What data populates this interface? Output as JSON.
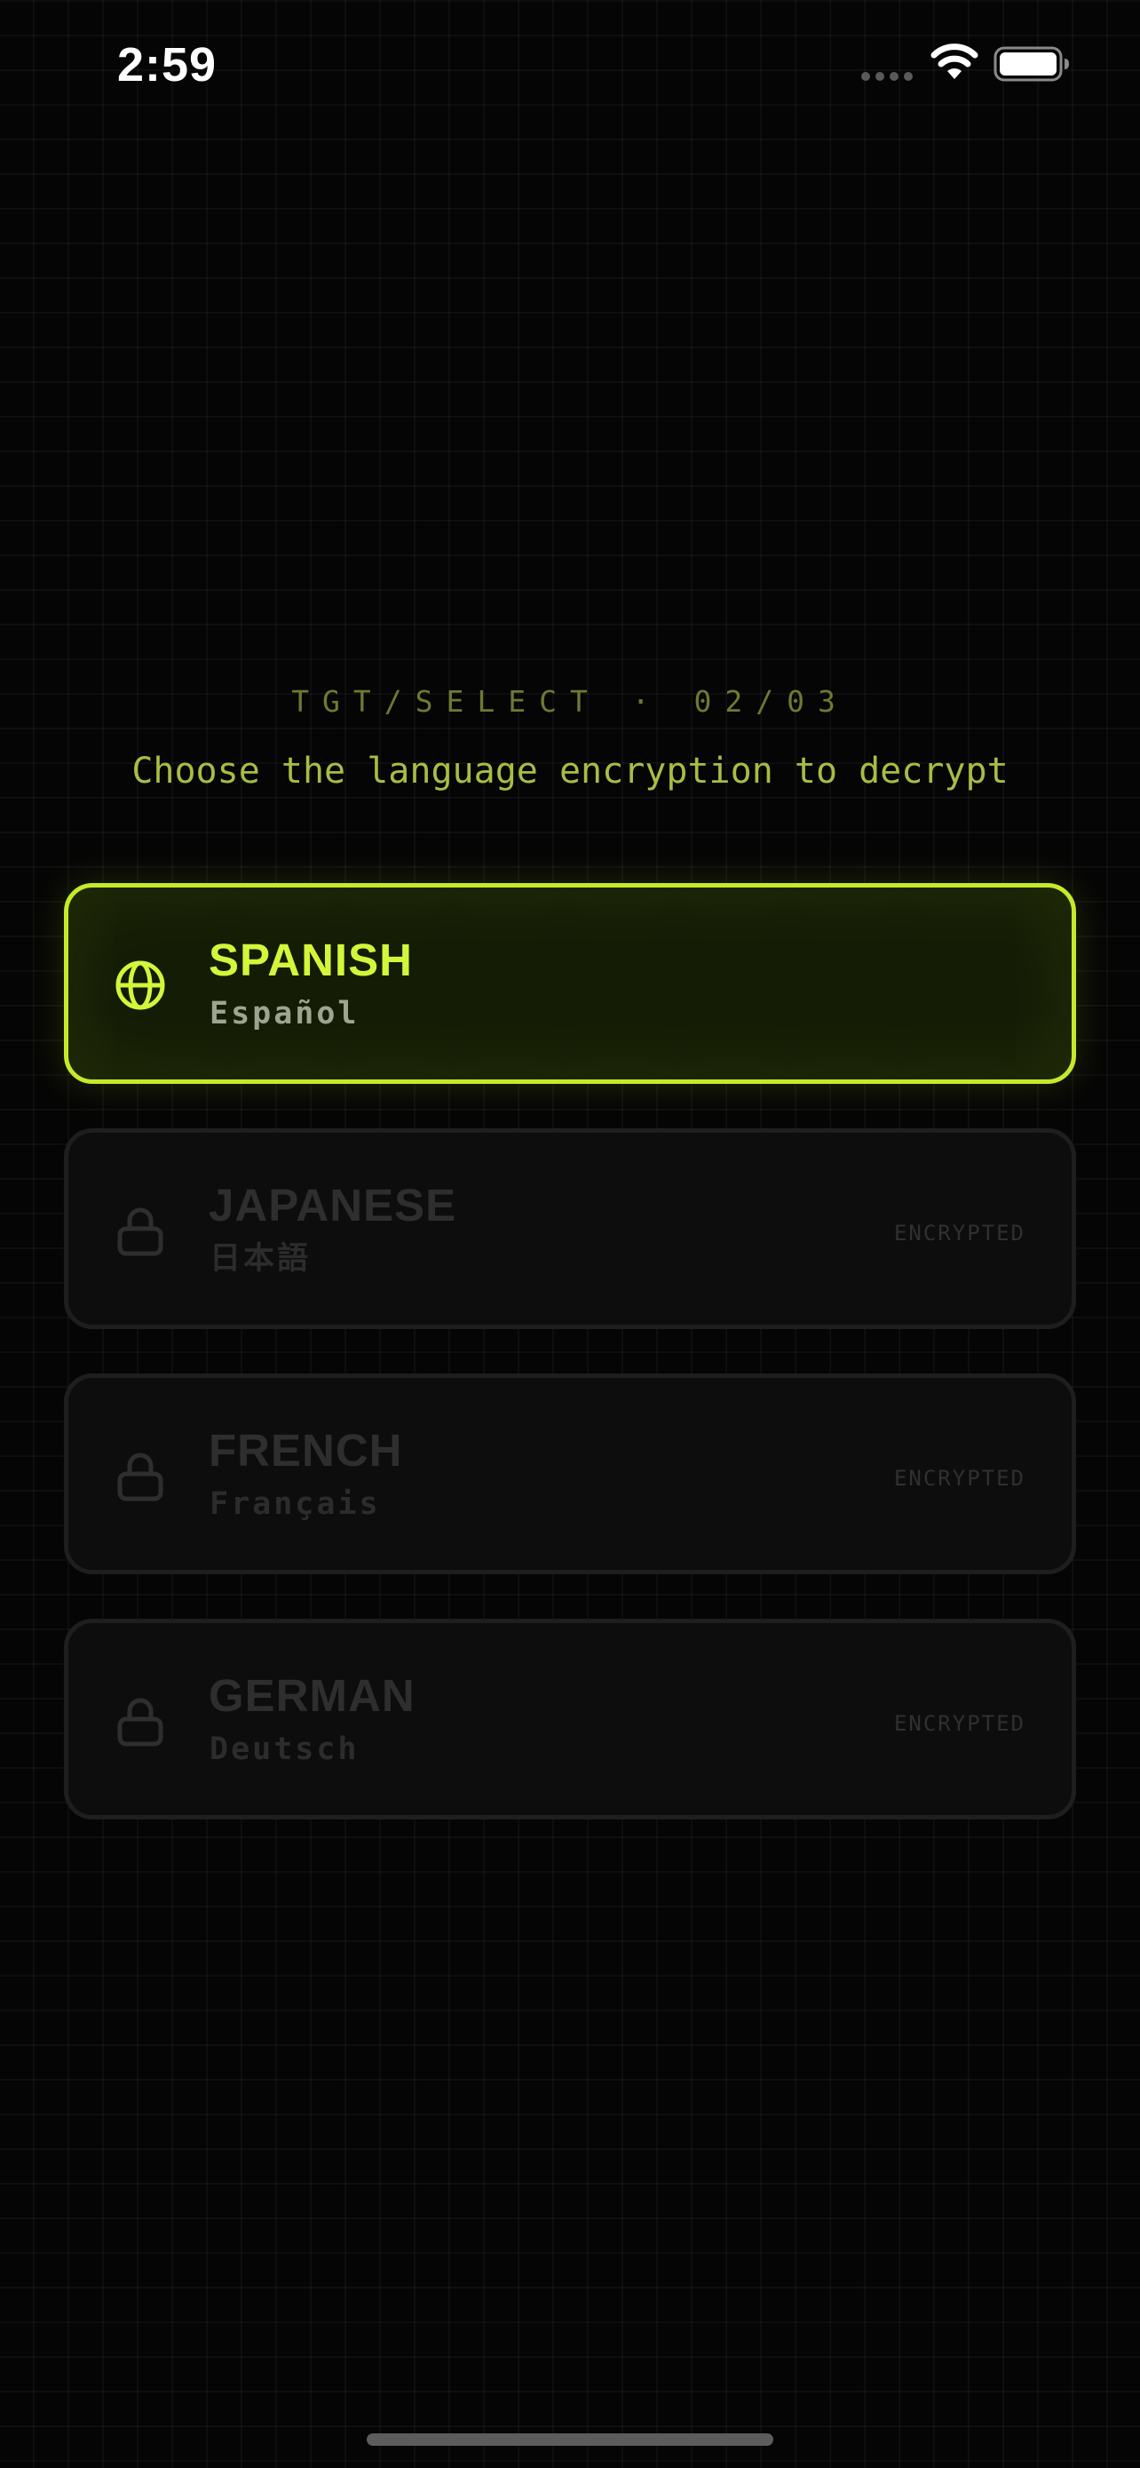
{
  "status_bar": {
    "time": "2:59",
    "signal_icon": "signal-dots-icon",
    "wifi_icon": "wifi-icon",
    "battery_icon": "battery-full-icon"
  },
  "header": {
    "step_label": "TGT/SELECT · 02/03",
    "subtitle": "Choose the language encryption to decrypt"
  },
  "languages": [
    {
      "name": "SPANISH",
      "native": "Español",
      "status": "",
      "selected": true,
      "locked": false,
      "icon": "globe-icon"
    },
    {
      "name": "JAPANESE",
      "native": "日本語",
      "status": "ENCRYPTED",
      "selected": false,
      "locked": true,
      "icon": "lock-icon"
    },
    {
      "name": "FRENCH",
      "native": "Français",
      "status": "ENCRYPTED",
      "selected": false,
      "locked": true,
      "icon": "lock-icon"
    },
    {
      "name": "GERMAN",
      "native": "Deutsch",
      "status": "ENCRYPTED",
      "selected": false,
      "locked": true,
      "icon": "lock-icon"
    }
  ],
  "colors": {
    "accent": "#c6ea2a",
    "accent_text": "#d4f53a",
    "muted_accent": "#a7bd44",
    "background": "#050505",
    "locked_text": "#2e2e2e"
  }
}
